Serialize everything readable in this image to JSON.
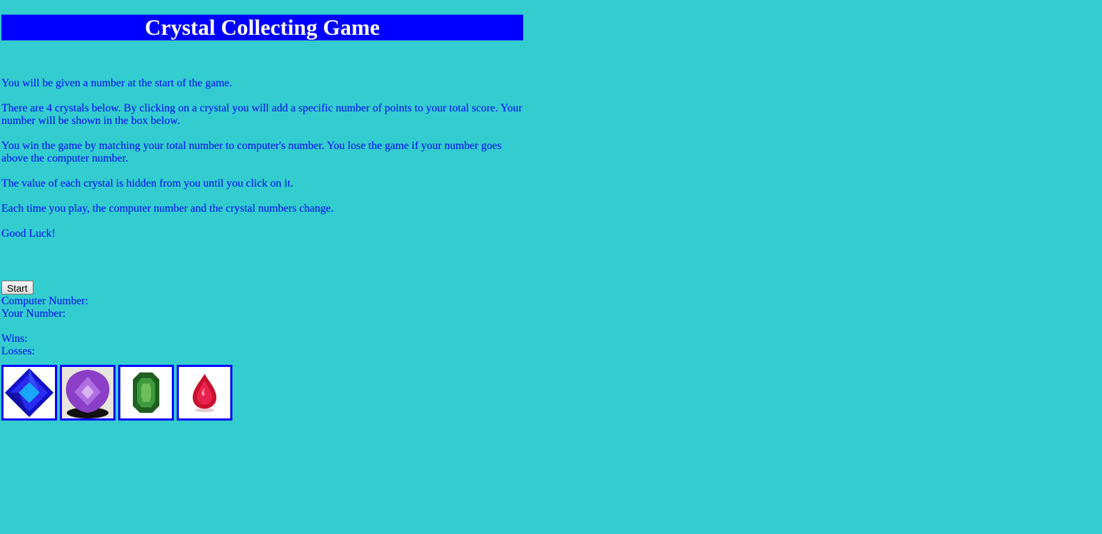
{
  "title": "Crystal Collecting Game",
  "instructions": [
    "You will be given a number at the start of the game.",
    "There are 4 crystals below. By clicking on a crystal you will add a specific number of points to your total score. Your number will be shown in the box below.",
    "You win the game by matching your total number to computer's number. You lose the game if your number goes above the computer number.",
    "The value of each crystal is hidden from you until you click on it.",
    "Each time you play, the computer number and the crystal numbers change.",
    "Good Luck!"
  ],
  "start_button": "Start",
  "stats": {
    "computer_number_label": "Computer Number:",
    "your_number_label": "Your Number:",
    "wins_label": "Wins:",
    "losses_label": "Losses:"
  },
  "crystals": [
    {
      "icon": "blue-crystal-icon",
      "color": "#1a1aff"
    },
    {
      "icon": "purple-crystal-icon",
      "color": "#9b4fd6"
    },
    {
      "icon": "green-crystal-icon",
      "color": "#2f7d2f"
    },
    {
      "icon": "red-crystal-icon",
      "color": "#d0103a"
    }
  ],
  "colors": {
    "background": "#33cccf",
    "title_bar": "#0000ff",
    "text": "#0000ff"
  }
}
